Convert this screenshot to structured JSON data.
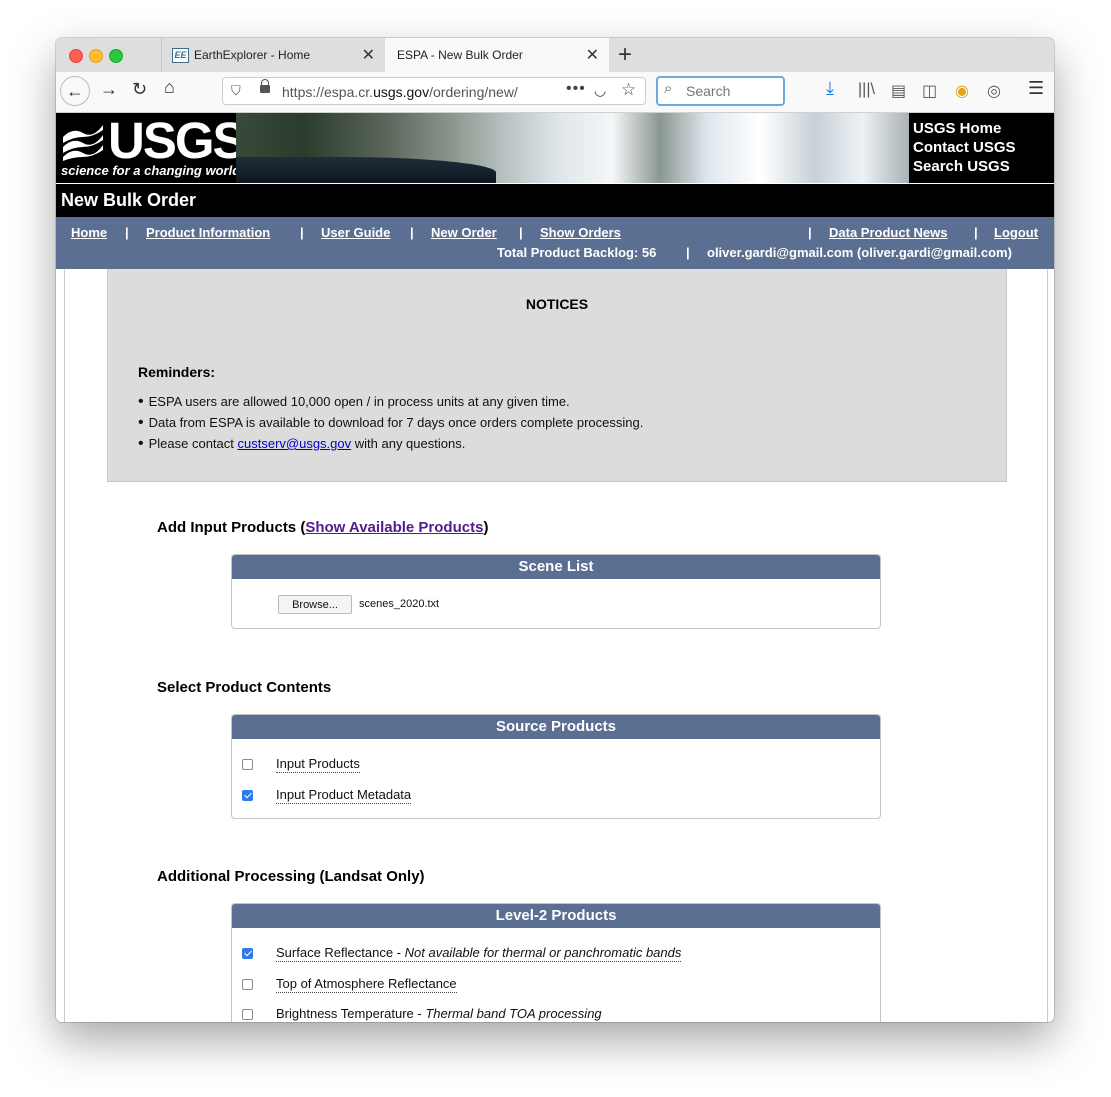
{
  "browser": {
    "tabs": [
      {
        "label": "EarthExplorer - Home",
        "favicon": "EE"
      },
      {
        "label": "ESPA - New Bulk Order"
      }
    ],
    "url_host_prefix": "https://espa.cr.",
    "url_host_main": "usgs.gov",
    "url_path": "/ordering/new/",
    "search_placeholder": "Search"
  },
  "header": {
    "logo_text": "USGS",
    "tagline": "science for a changing world",
    "links": [
      "USGS Home",
      "Contact USGS",
      "Search USGS"
    ],
    "page_title": "New Bulk Order"
  },
  "nav": {
    "items": [
      "Home",
      "Product Information",
      "User Guide",
      "New Order",
      "Show Orders"
    ],
    "right_items": [
      "Data Product News",
      "Logout"
    ],
    "separator": "|",
    "backlog": "Total Product Backlog: 56",
    "user": "oliver.gardi@gmail.com (oliver.gardi@gmail.com)"
  },
  "notices": {
    "title": "NOTICES",
    "reminders_label": "Reminders:",
    "items": [
      "ESPA users are allowed 10,000 open / in process units at any given time.",
      "Data from ESPA is available to download for 7 days once orders complete processing."
    ],
    "contact_prefix": "Please contact ",
    "contact_email": "custserv@usgs.gov",
    "contact_suffix": " with any questions."
  },
  "input_products": {
    "heading": "Add Input Products (",
    "heading_link": "Show Available Products",
    "heading_close": ")",
    "panel_title": "Scene List",
    "browse_label": "Browse...",
    "file_name": "scenes_2020.txt"
  },
  "product_contents": {
    "heading": "Select Product Contents",
    "panel_title": "Source Products",
    "options": [
      {
        "label": "Input Products",
        "checked": false
      },
      {
        "label": "Input Product Metadata",
        "checked": true
      }
    ]
  },
  "additional_processing": {
    "heading": "Additional Processing (Landsat Only)",
    "panel_title": "Level-2 Products",
    "options": [
      {
        "label": "Surface Reflectance - ",
        "note": "Not available for thermal or panchromatic bands",
        "checked": true
      },
      {
        "label": "Top of Atmosphere Reflectance",
        "note": "",
        "checked": false
      },
      {
        "label": "Brightness Temperature - ",
        "note": "Thermal band TOA processing",
        "checked": false
      }
    ]
  },
  "icons": [
    "back-icon",
    "forward-icon",
    "reload-icon",
    "home-icon",
    "shield-icon",
    "lock-icon",
    "more-icon",
    "pocket-icon",
    "bookmark-star-icon",
    "search-icon",
    "download-icon",
    "library-icon",
    "reader-icon",
    "sidebar-icon",
    "extension-icon",
    "account-icon",
    "menu-icon"
  ],
  "colors": {
    "nav_bar": "#5b6f92",
    "panel_header": "#5b6f92",
    "notice_bg": "#dcdcdc",
    "checkbox_checked": "#2f7bea",
    "link_visited": "#551a8b"
  }
}
